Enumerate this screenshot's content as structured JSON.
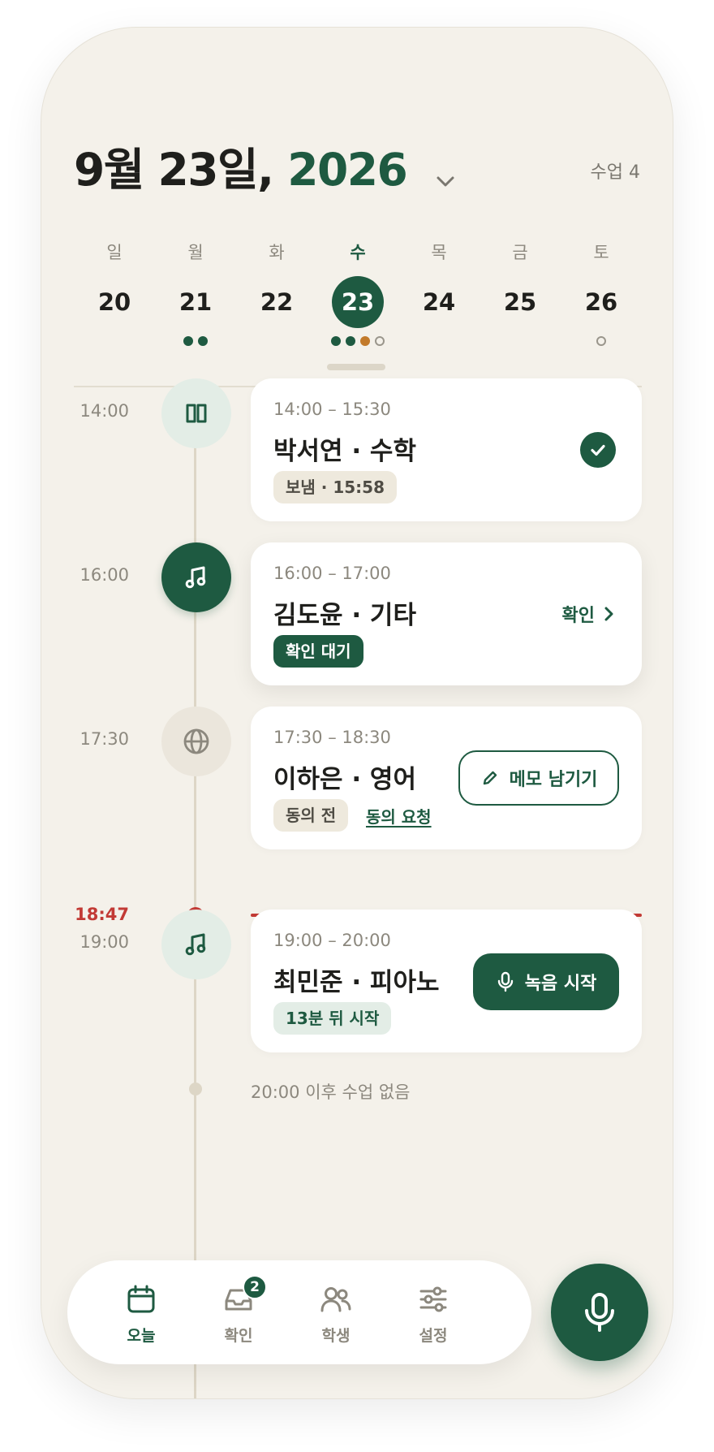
{
  "header": {
    "date_prefix": "9월 23일, ",
    "year": "2026",
    "lesson_count": "수업 4"
  },
  "week": [
    {
      "dow": "일",
      "date": "20",
      "dots": []
    },
    {
      "dow": "월",
      "date": "21",
      "dots": [
        "green",
        "green"
      ]
    },
    {
      "dow": "화",
      "date": "22",
      "dots": []
    },
    {
      "dow": "수",
      "date": "23",
      "dots": [
        "green",
        "green",
        "orange",
        "hollow"
      ],
      "selected": true
    },
    {
      "dow": "목",
      "date": "24",
      "dots": []
    },
    {
      "dow": "금",
      "date": "25",
      "dots": []
    },
    {
      "dow": "토",
      "date": "26",
      "dots": [
        "hollow"
      ]
    }
  ],
  "lessons": [
    {
      "slot": "14:00",
      "range": "14:00 – 15:30",
      "name": "박서연 · 수학",
      "tag": "보냄 · 15:58",
      "icon": "book-icon",
      "status": "sent"
    },
    {
      "slot": "16:00",
      "range": "16:00 – 17:00",
      "name": "김도윤 · 기타",
      "tag": "확인 대기",
      "action": "확인",
      "icon": "music-note-icon",
      "status": "pending"
    },
    {
      "slot": "17:30",
      "range": "17:30 – 18:30",
      "name": "이하은 · 영어",
      "tag": "동의 전",
      "link": "동의 요청",
      "action": "메모 남기기",
      "icon": "globe-icon",
      "status": "no-consent"
    },
    {
      "slot": "19:00",
      "range": "19:00 – 20:00",
      "name": "최민준 · 피아노",
      "tag": "13분 뒤 시작",
      "action": "녹음 시작",
      "icon": "music-note-icon",
      "status": "upcoming"
    }
  ],
  "now": {
    "time": "18:47"
  },
  "end_message": "20:00 이후 수업 없음",
  "nav": [
    {
      "label": "오늘",
      "icon": "calendar-icon",
      "active": true
    },
    {
      "label": "확인",
      "icon": "inbox-icon",
      "badge": "2"
    },
    {
      "label": "학생",
      "icon": "users-icon"
    },
    {
      "label": "설정",
      "icon": "sliders-icon"
    }
  ],
  "colors": {
    "accent": "#1e5a41",
    "now": "#c23a35",
    "background": "#f4f1ea",
    "orange": "#c27a2a"
  }
}
